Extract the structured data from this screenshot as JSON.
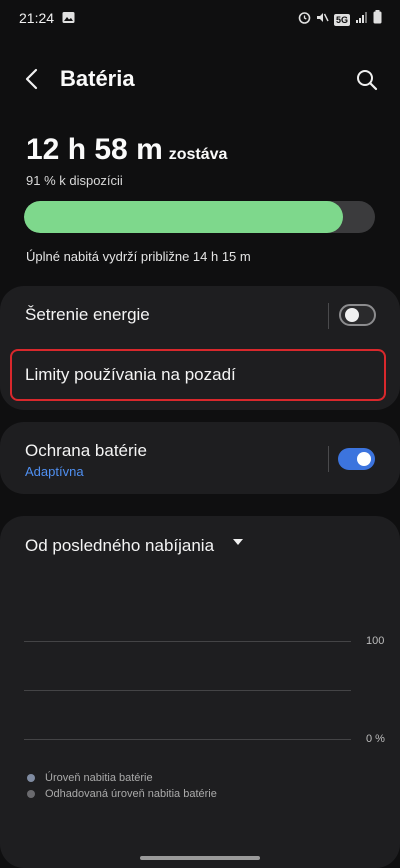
{
  "status_bar": {
    "time": "21:24",
    "signal_label": "5G"
  },
  "header": {
    "title": "Batéria"
  },
  "summary": {
    "remaining_time": "12 h 58 m",
    "remaining_unit": "zostáva",
    "available": "91 % k dispozícii",
    "level_fraction": 0.91,
    "full_charge_text": "Úplné nabitá vydrží približne 14 h 15 m"
  },
  "settings": {
    "power_saving": {
      "label": "Šetrenie energie",
      "enabled": false
    },
    "background_limits": {
      "label": "Limity používania na pozadí"
    },
    "battery_protection": {
      "label": "Ochrana batérie",
      "sub": "Adaptívna",
      "enabled": true
    }
  },
  "usage": {
    "period_label": "Od posledného nabíjania",
    "axis_top": "100",
    "axis_bottom": "0 %",
    "legend": [
      {
        "label": "Úroveň nabitia batérie",
        "color": "#7f8ba1"
      },
      {
        "label": "Odhadovaná úroveň nabitia batérie",
        "color": "#6a6a6e"
      }
    ]
  },
  "colors": {
    "accent": "#3c74de",
    "bar": "#7ed88c",
    "highlight": "#d9282c"
  },
  "icons": {
    "back": "arrow-left-icon",
    "search": "search-icon",
    "dropdown": "triangle-down-icon"
  }
}
